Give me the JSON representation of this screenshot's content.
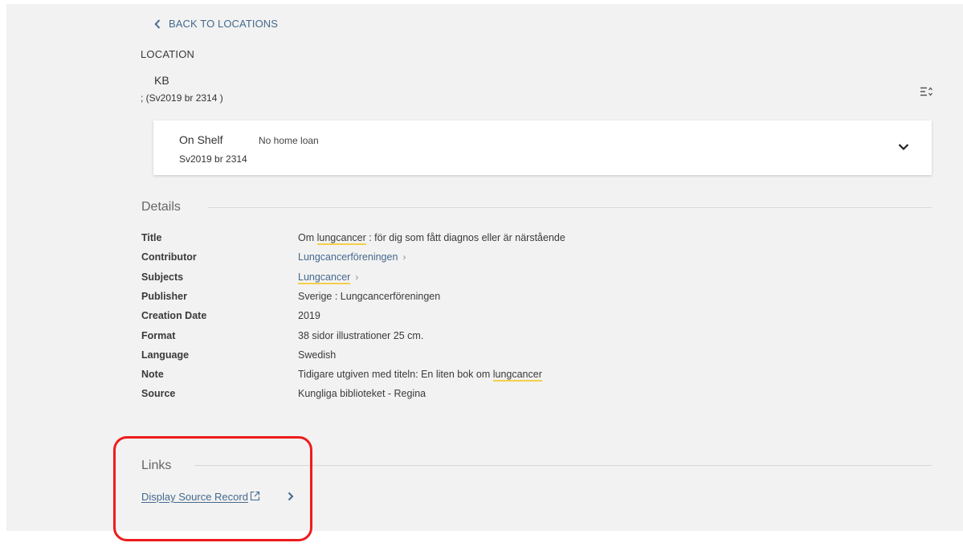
{
  "nav": {
    "back_label": "BACK TO LOCATIONS"
  },
  "location": {
    "heading": "LOCATION",
    "name": "KB",
    "call_number": "; (Sv2019 br 2314 )",
    "item": {
      "status": "On Shelf",
      "call_number": "Sv2019 br 2314",
      "loan_policy": "No home loan"
    }
  },
  "details": {
    "heading": "Details",
    "rows": [
      {
        "label": "Title",
        "pre": "Om ",
        "highlight": "lungcancer",
        "post": " : för dig som fått diagnos eller är närstående"
      },
      {
        "label": "Contributor",
        "link": "Lungcancerföreningen"
      },
      {
        "label": "Subjects",
        "link_highlight": "Lungcancer"
      },
      {
        "label": "Publisher",
        "value": "Sverige : Lungcancerföreningen"
      },
      {
        "label": "Creation Date",
        "value": "2019"
      },
      {
        "label": "Format",
        "value": "38 sidor illustrationer 25 cm."
      },
      {
        "label": "Language",
        "value": "Swedish"
      },
      {
        "label": "Note",
        "pre": "Tidigare utgiven med titeln: En liten bok om ",
        "highlight": "lungcancer",
        "post": ""
      },
      {
        "label": "Source",
        "value": "Kungliga biblioteket - Regina"
      }
    ]
  },
  "links": {
    "heading": "Links",
    "display_source_label": "Display Source Record"
  },
  "colors": {
    "link": "#44698e",
    "highlight": "#f3cf4b",
    "annotation": "#ee1c1c",
    "panel": "#f2f2f2"
  },
  "icons": [
    "chevron-left-icon",
    "sort-icon",
    "chevron-down-icon",
    "chevron-right-icon",
    "external-link-icon"
  ]
}
